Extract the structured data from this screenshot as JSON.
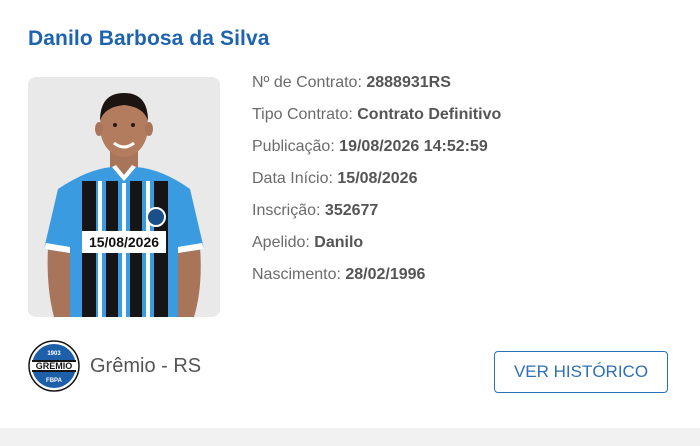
{
  "player": {
    "name": "Danilo Barbosa da Silva",
    "photo_date": "15/08/2026"
  },
  "details": [
    {
      "label": "Nº de Contrato:",
      "value": "2888931RS"
    },
    {
      "label": "Tipo Contrato:",
      "value": "Contrato Definitivo"
    },
    {
      "label": "Publicação:",
      "value": "19/08/2026 14:52:59"
    },
    {
      "label": "Data Início:",
      "value": "15/08/2026"
    },
    {
      "label": "Inscrição:",
      "value": "352677"
    },
    {
      "label": "Apelido:",
      "value": "Danilo"
    },
    {
      "label": "Nascimento:",
      "value": "28/02/1996"
    }
  ],
  "club": {
    "name": "Grêmio - RS",
    "logo_text": "GRÊMIO",
    "logo_year_top": "1903",
    "logo_year_bottom": "FBPA",
    "logo_icon": "club-crest-icon"
  },
  "actions": {
    "history_label": "VER HISTÓRICO"
  },
  "colors": {
    "accent": "#1d63b0",
    "button_border": "#2d6fb8",
    "jersey_blue": "#3b9be0",
    "jersey_black": "#151515"
  }
}
